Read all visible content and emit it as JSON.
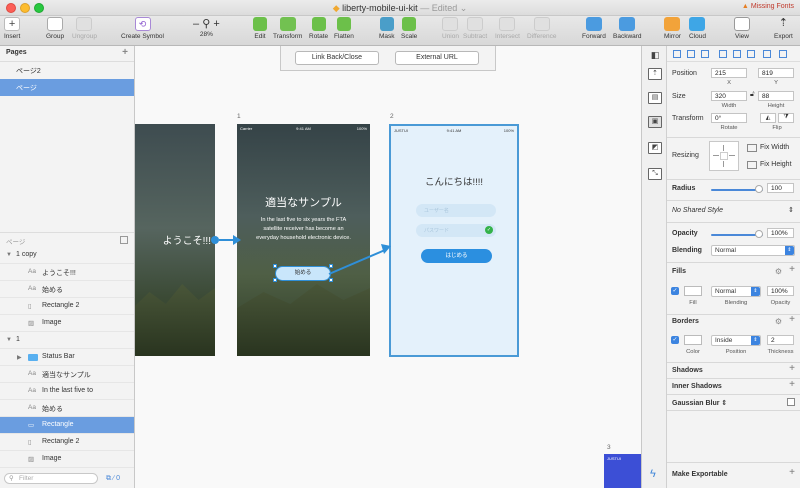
{
  "window": {
    "title": "liberty-mobile-ui-kit",
    "edited": "— Edited",
    "missing_fonts": "Missing Fonts"
  },
  "toolbar": {
    "insert": "Insert",
    "group": "Group",
    "ungroup": "Ungroup",
    "create_symbol": "Create Symbol",
    "zoom_value": "28%",
    "edit": "Edit",
    "transform": "Transform",
    "rotate": "Rotate",
    "flatten": "Flatten",
    "mask": "Mask",
    "scale": "Scale",
    "union": "Union",
    "subtract": "Subtract",
    "intersect": "Intersect",
    "difference": "Difference",
    "forward": "Forward",
    "backward": "Backward",
    "mirror": "Mirror",
    "cloud": "Cloud",
    "view": "View",
    "export": "Export"
  },
  "pages": {
    "header": "Pages",
    "items": [
      "ページ2",
      "ページ"
    ]
  },
  "layers": {
    "header": "ページ",
    "rows": [
      {
        "label": "1 copy",
        "icon": "",
        "level": 0,
        "kind": "group"
      },
      {
        "label": "ようこそ!!!",
        "icon": "Aa",
        "level": 1,
        "kind": "text"
      },
      {
        "label": "始める",
        "icon": "Aa",
        "level": 1,
        "kind": "text"
      },
      {
        "label": "Rectangle 2",
        "icon": "▯",
        "level": 1,
        "kind": "shape"
      },
      {
        "label": "Image",
        "icon": "▨",
        "level": 1,
        "kind": "image"
      },
      {
        "label": "1",
        "icon": "",
        "level": 0,
        "kind": "group"
      },
      {
        "label": "Status Bar",
        "icon": "",
        "level": 1,
        "kind": "folder"
      },
      {
        "label": "適当なサンプル",
        "icon": "Aa",
        "level": 1,
        "kind": "text"
      },
      {
        "label": "In the last five to",
        "icon": "Aa",
        "level": 1,
        "kind": "text"
      },
      {
        "label": "始める",
        "icon": "Aa",
        "level": 1,
        "kind": "text"
      },
      {
        "label": "Rectangle",
        "icon": "▭",
        "level": 1,
        "kind": "shape",
        "selected": true
      },
      {
        "label": "Rectangle 2",
        "icon": "▯",
        "level": 1,
        "kind": "shape"
      },
      {
        "label": "Image",
        "icon": "▨",
        "level": 1,
        "kind": "image"
      }
    ],
    "filter_placeholder": "Filter",
    "filter_count": "0"
  },
  "canvas": {
    "link_back": "Link Back/Close",
    "external_url": "External URL",
    "artboard1_label": "1",
    "artboard2_label": "2",
    "artboard3_label": "3",
    "welcome": "ようこそ!!!",
    "ab1_title": "適当なサンプル",
    "ab1_body": "In the last five to six years the FTA satellite receiver has become an everyday household electronic device.",
    "ab1_button": "始める",
    "ab2_title": "こんにちは!!!!",
    "ab2_input1": "ユーザー名",
    "ab2_input2": "パスワード",
    "ab2_button": "はじめる",
    "status_carrier": "Carrier",
    "status_time": "9:41 AM",
    "status_battery": "100%",
    "status_carrier2": "JUSTUI"
  },
  "inspector": {
    "position_label": "Position",
    "x": "215",
    "y": "819",
    "x_label": "X",
    "y_label": "Y",
    "size_label": "Size",
    "width": "320",
    "height": "88",
    "width_label": "Width",
    "height_label": "Height",
    "transform_label": "Transform",
    "rotate_value": "0°",
    "rotate_label": "Rotate",
    "flip_label": "Flip",
    "resizing_label": "Resizing",
    "fix_width": "Fix Width",
    "fix_height": "Fix Height",
    "radius_label": "Radius",
    "radius_value": "100",
    "shared_style": "No Shared Style",
    "opacity_label": "Opacity",
    "opacity_value": "100%",
    "opacity_fraction": 1.0,
    "blending_label": "Blending",
    "blending_value": "Normal",
    "fills_label": "Fills",
    "fill_blend": "Normal",
    "fill_opacity": "100%",
    "fill_sub": "Fill",
    "fill_blend_sub": "Blending",
    "fill_opacity_sub": "Opacity",
    "borders_label": "Borders",
    "border_position": "Inside",
    "border_thickness": "2",
    "border_color_sub": "Color",
    "border_position_sub": "Position",
    "border_thickness_sub": "Thickness",
    "shadows_label": "Shadows",
    "inner_shadows_label": "Inner Shadows",
    "gaussian_label": "Gaussian Blur",
    "make_exportable": "Make Exportable"
  },
  "colors": {
    "accent": "#3c84e0",
    "selection": "#6a9de0",
    "prototype_link": "#2f8fd8"
  }
}
